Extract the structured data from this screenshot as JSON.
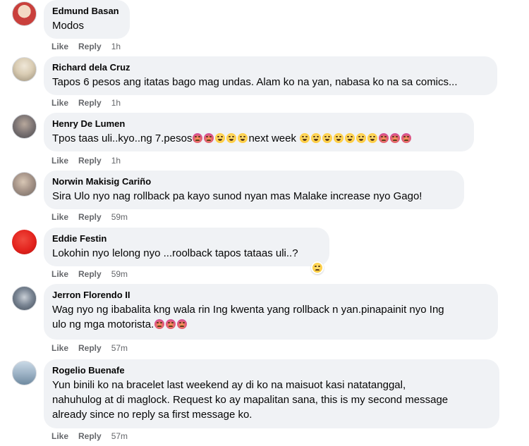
{
  "labels": {
    "like": "Like",
    "reply": "Reply"
  },
  "comments": [
    {
      "author": "Edmund Basan",
      "text": "Modos",
      "time": "1h",
      "avatar_color": "#c9403c"
    },
    {
      "author": "Richard dela Cruz",
      "text": "Tapos 6 pesos ang itatas bago mag undas. Alam ko na yan, nabasa ko na sa comics...",
      "time": "1h",
      "avatar_color": "#b9a98a"
    },
    {
      "author": "Henry De Lumen",
      "text_before": "Tpos taas uli..kyo..ng 7.pesos",
      "text_middle": "next week",
      "time": "1h",
      "avatar_color": "#6b6a6c",
      "emojis_before": [
        "angry",
        "angry",
        "laugh",
        "laugh",
        "laugh"
      ],
      "emojis_after": [
        "laugh",
        "laugh",
        "laugh",
        "laugh",
        "laugh",
        "laugh",
        "laugh",
        "angry",
        "angry",
        "angry"
      ]
    },
    {
      "author": "Norwin Makisig Cariño",
      "text": "Sira Ulo nyo nag rollback pa kayo sunod nyan mas Malake increase nyo Gago!",
      "time": "59m",
      "avatar_color": "#8a7c70"
    },
    {
      "author": "Eddie Festin",
      "text": "Lokohin nyo lelong nyo ...roolback tapos tataas uli..?",
      "time": "59m",
      "avatar_color": "#e3231d",
      "reaction": "sad"
    },
    {
      "author": "Jerron Florendo II",
      "text_lines": [
        "Wag nyo ng ibabalita kng wala rin Ing kwenta yang rollback n yan.pinapainit nyo Ing",
        "ulo ng mga motorista."
      ],
      "time": "57m",
      "avatar_color": "#4c5a6b",
      "emojis_after": [
        "angry",
        "angry",
        "angry"
      ]
    },
    {
      "author": "Rogelio Buenafe",
      "text_lines": [
        "Yun binili ko na bracelet last weekend ay di ko na maisuot kasi natatanggal,",
        "nahuhulog at di maglock. Request ko ay mapalitan sana, this is my second message",
        "already since no reply sa first message ko."
      ],
      "time": "57m",
      "avatar_color": "#6f8aa0"
    }
  ]
}
